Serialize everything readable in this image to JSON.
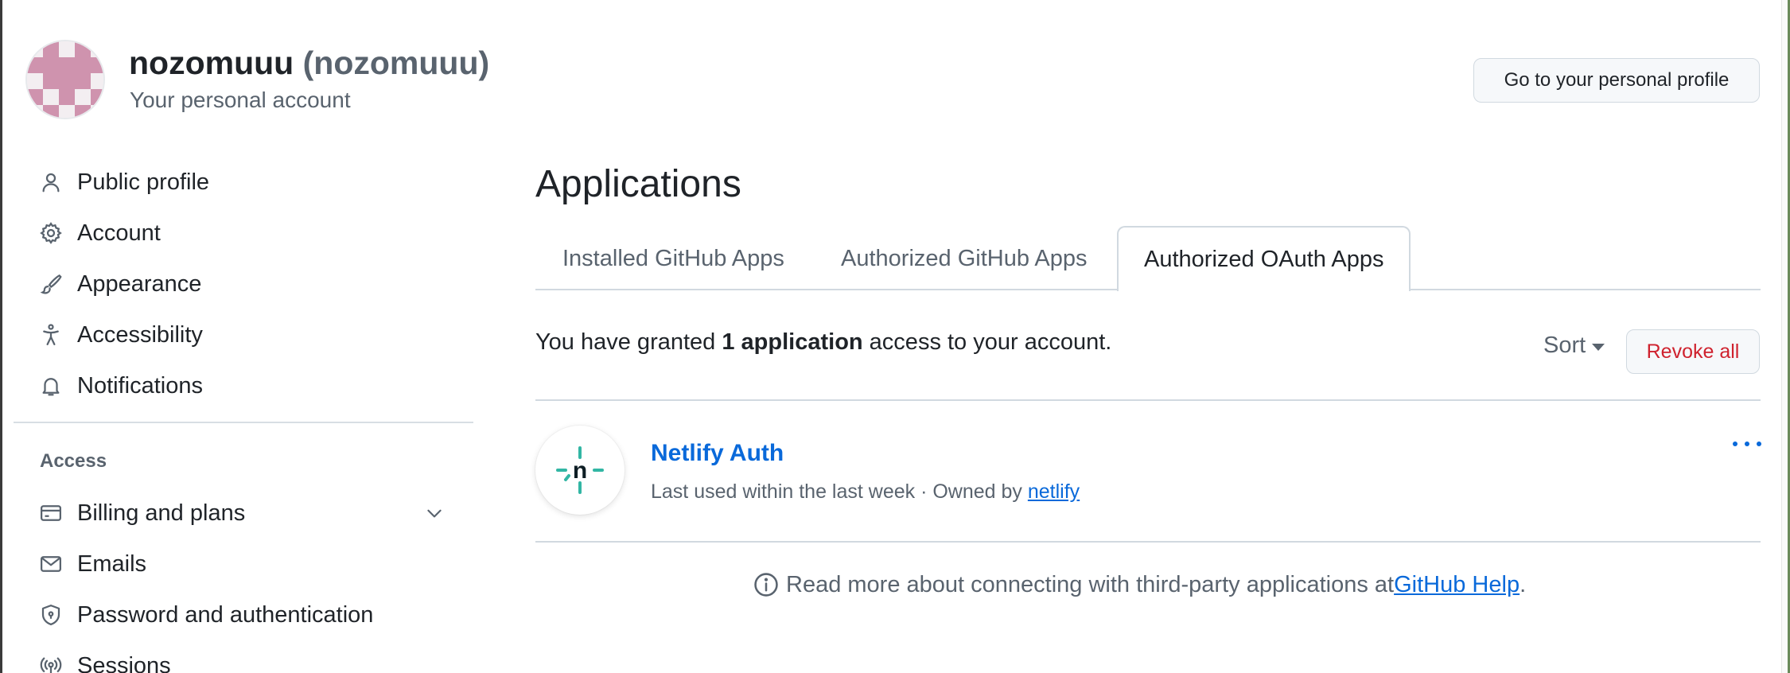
{
  "account": {
    "display_name": "nozomuuu",
    "login": "(nozomuuu)",
    "subtitle": "Your personal account",
    "profile_button": "Go to your personal profile"
  },
  "sidebar": {
    "items": [
      {
        "label": "Public profile",
        "icon": "person-icon"
      },
      {
        "label": "Account",
        "icon": "gear-icon"
      },
      {
        "label": "Appearance",
        "icon": "paintbrush-icon"
      },
      {
        "label": "Accessibility",
        "icon": "accessibility-icon"
      },
      {
        "label": "Notifications",
        "icon": "bell-icon"
      }
    ],
    "access_heading": "Access",
    "access_items": [
      {
        "label": "Billing and plans",
        "icon": "credit-card-icon"
      },
      {
        "label": "Emails",
        "icon": "mail-icon"
      },
      {
        "label": "Password and authentication",
        "icon": "shield-lock-icon"
      },
      {
        "label": "Sessions",
        "icon": "broadcast-icon"
      }
    ]
  },
  "main": {
    "title": "Applications",
    "tabs": [
      {
        "label": "Installed GitHub Apps",
        "active": false
      },
      {
        "label": "Authorized GitHub Apps",
        "active": false
      },
      {
        "label": "Authorized OAuth Apps",
        "active": true
      }
    ],
    "grant": {
      "prefix": "You have granted ",
      "count": "1 application",
      "suffix": " access to your account."
    },
    "sort_label": "Sort",
    "revoke_all_label": "Revoke all",
    "apps": [
      {
        "name": "Netlify Auth",
        "meta_prefix": "Last used within the last week · Owned by ",
        "owner": "netlify",
        "logo_letter": "n",
        "icon": "netlify-logo"
      }
    ],
    "help": {
      "text": "Read more about connecting with third-party applications at ",
      "link": "GitHub Help",
      "period": "."
    }
  },
  "colors": {
    "accent": "#0969da",
    "danger": "#cf222e",
    "muted": "#59636e",
    "netlify_teal": "#32b6a4"
  }
}
